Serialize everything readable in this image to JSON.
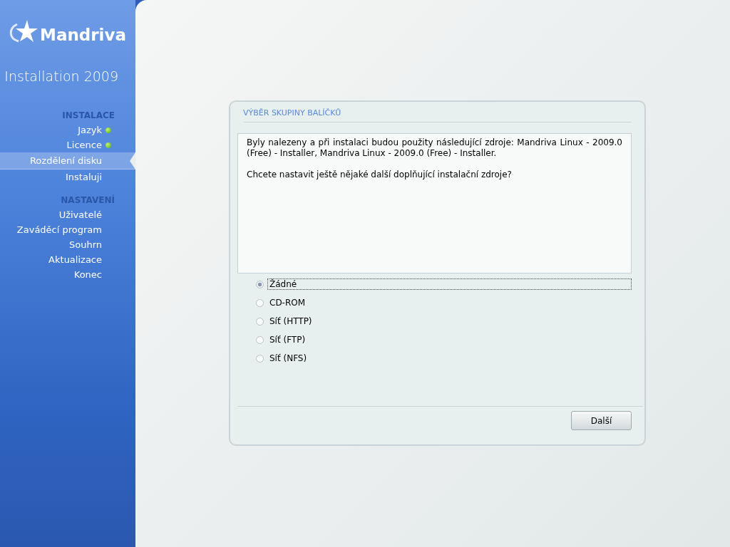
{
  "sidebar": {
    "logo_text": "Mandriva",
    "subtitle": "Installation 2009",
    "sections": [
      {
        "heading": "INSTALACE",
        "items": [
          {
            "label": "Jazyk",
            "done": true,
            "selected": false
          },
          {
            "label": "Licence",
            "done": true,
            "selected": false
          },
          {
            "label": "Rozdělení disku",
            "done": false,
            "selected": true
          },
          {
            "label": "Instaluji",
            "done": false,
            "selected": false
          }
        ]
      },
      {
        "heading": "NASTAVENÍ",
        "items": [
          {
            "label": "Uživatelé",
            "done": false,
            "selected": false
          },
          {
            "label": "Zaváděcí program",
            "done": false,
            "selected": false
          },
          {
            "label": "Souhrn",
            "done": false,
            "selected": false
          },
          {
            "label": "Aktualizace",
            "done": false,
            "selected": false
          },
          {
            "label": "Konec",
            "done": false,
            "selected": false
          }
        ]
      }
    ]
  },
  "dialog": {
    "title": "VÝBĚR SKUPINY BALÍČKŮ",
    "paragraphs": [
      "Byly nalezeny a při instalaci budou použity následující zdroje: Mandriva Linux - 2009.0 (Free) - Installer, Mandriva Linux - 2009.0 (Free) - Installer.",
      "Chcete nastavit ještě nějaké další doplňující instalační zdroje?"
    ],
    "options": [
      {
        "label": "Žádné",
        "selected": true
      },
      {
        "label": "CD-ROM",
        "selected": false
      },
      {
        "label": "Síť (HTTP)",
        "selected": false
      },
      {
        "label": "Síť (FTP)",
        "selected": false
      },
      {
        "label": "Síť (NFS)",
        "selected": false
      }
    ],
    "buttons": [
      "Další"
    ]
  }
}
